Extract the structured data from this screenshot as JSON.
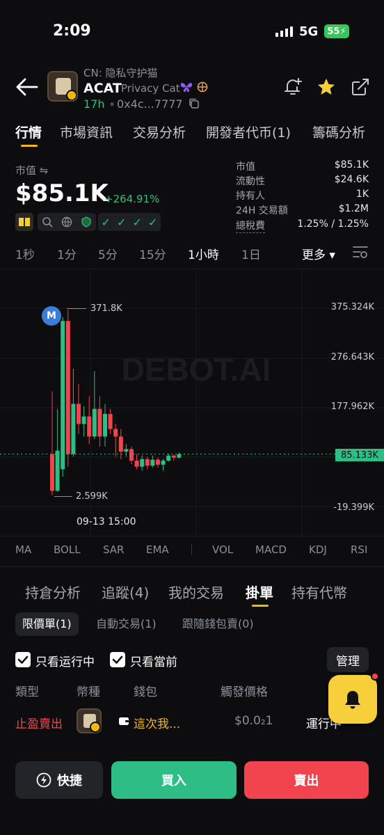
{
  "status_bar": {
    "time": "2:09",
    "network": "5G",
    "battery": "55"
  },
  "token": {
    "cn_name": "CN: 隐私守护猫",
    "symbol": "ACAT",
    "name": "Privacy Cat",
    "age": "17h",
    "address": "0x4c...7777"
  },
  "main_tabs": [
    "行情",
    "市場資訊",
    "交易分析",
    "開發者代币(1)",
    "籌碼分析"
  ],
  "market": {
    "label": "市值 ⇋",
    "value": "$85.1K",
    "change": "+264.91%",
    "change_color": "#2fbd86"
  },
  "stats": [
    {
      "label": "市值",
      "value": "$85.1K"
    },
    {
      "label": "流動性",
      "value": "$24.6K"
    },
    {
      "label": "持有人",
      "value": "1K"
    },
    {
      "label": "24H 交易額",
      "value": "$1.2M"
    },
    {
      "label": "總稅費",
      "value": "1.25% / 1.25%"
    }
  ],
  "intervals": [
    "1秒",
    "1分",
    "5分",
    "15分",
    "1小時",
    "1日"
  ],
  "active_interval": "1小時",
  "more_label": "更多",
  "chart": {
    "watermark": "DEBOT.AI",
    "y_labels": [
      "375.324K",
      "276.643K",
      "177.962K",
      "85.133K",
      "-19.399K"
    ],
    "high_label": "371.8K",
    "low_label": "2.599K",
    "marker": "M",
    "time_label": "09-13 15:00",
    "current_price": "85.133K"
  },
  "chart_data": {
    "type": "candlestick",
    "x_label": "09-13 15:00",
    "ylim": [
      -19.399,
      375.324
    ],
    "y_unit": "K",
    "candles": [
      {
        "open": 85,
        "close": 12,
        "high": 210,
        "low": 3
      },
      {
        "open": 12,
        "close": 92,
        "high": 175,
        "low": 10
      },
      {
        "open": 55,
        "close": 350,
        "high": 358,
        "low": 40
      },
      {
        "open": 350,
        "close": 85,
        "high": 371.8,
        "low": 60
      },
      {
        "open": 85,
        "close": 185,
        "high": 255,
        "low": 80
      },
      {
        "open": 185,
        "close": 145,
        "high": 225,
        "low": 125
      },
      {
        "open": 145,
        "close": 160,
        "high": 180,
        "low": 120
      },
      {
        "open": 160,
        "close": 120,
        "high": 200,
        "low": 105
      },
      {
        "open": 120,
        "close": 175,
        "high": 250,
        "low": 115
      },
      {
        "open": 175,
        "close": 120,
        "high": 200,
        "low": 100
      },
      {
        "open": 120,
        "close": 165,
        "high": 185,
        "low": 100
      },
      {
        "open": 165,
        "close": 135,
        "high": 175,
        "low": 125
      },
      {
        "open": 135,
        "close": 120,
        "high": 145,
        "low": 80
      },
      {
        "open": 120,
        "close": 90,
        "high": 135,
        "low": 75
      },
      {
        "open": 90,
        "close": 95,
        "high": 105,
        "low": 80
      },
      {
        "open": 95,
        "close": 72,
        "high": 100,
        "low": 65
      },
      {
        "open": 72,
        "close": 60,
        "high": 85,
        "low": 55
      },
      {
        "open": 60,
        "close": 75,
        "high": 82,
        "low": 52
      },
      {
        "open": 75,
        "close": 62,
        "high": 80,
        "low": 55
      },
      {
        "open": 62,
        "close": 74,
        "high": 82,
        "low": 58
      },
      {
        "open": 74,
        "close": 64,
        "high": 78,
        "low": 58
      },
      {
        "open": 64,
        "close": 72,
        "high": 76,
        "low": 52
      },
      {
        "open": 72,
        "close": 82,
        "high": 86,
        "low": 70
      },
      {
        "open": 82,
        "close": 78,
        "high": 84,
        "low": 72
      },
      {
        "open": 78,
        "close": 85,
        "high": 88,
        "low": 76
      }
    ]
  },
  "indicators": [
    "MA",
    "BOLL",
    "SAR",
    "EMA",
    "VOL",
    "MACD",
    "KDJ",
    "RSI"
  ],
  "lower_tabs": [
    "持倉分析",
    "追蹤(4)",
    "我的交易",
    "掛單",
    "持有代幣"
  ],
  "sub_tabs": [
    "限價單(1)",
    "自動交易(1)",
    "跟隨錢包賣(0)"
  ],
  "filters": {
    "running_only": "只看运行中",
    "current_only": "只看當前",
    "manage": "管理"
  },
  "table": {
    "headers": [
      "類型",
      "幣種",
      "錢包",
      "觸發價格"
    ],
    "row": {
      "type": "止盈賣出",
      "wallet": "這次我...",
      "price": "$0.0₂1",
      "status": "運行中"
    }
  },
  "actions": {
    "fast": "快捷",
    "buy": "買入",
    "sell": "賣出"
  },
  "colors": {
    "up": "#2fbd86",
    "down": "#f0454f",
    "accent": "#f0b90b"
  }
}
